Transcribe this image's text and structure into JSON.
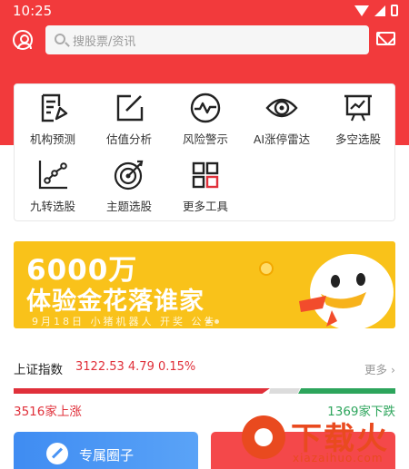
{
  "status_bar": {
    "time": "10:25"
  },
  "header": {
    "search_placeholder": "搜股票/资讯"
  },
  "tools": [
    {
      "label": "机构预测",
      "icon": "report-edit-icon"
    },
    {
      "label": "估值分析",
      "icon": "edit-square-icon"
    },
    {
      "label": "风险警示",
      "icon": "pulse-circle-icon"
    },
    {
      "label": "AI涨停雷达",
      "icon": "eye-icon"
    },
    {
      "label": "多空选股",
      "icon": "presentation-board-icon"
    },
    {
      "label": "九转选股",
      "icon": "trend-chart-icon"
    },
    {
      "label": "主题选股",
      "icon": "target-icon"
    },
    {
      "label": "更多工具",
      "icon": "grid-icon"
    }
  ],
  "banner": {
    "line1": "6000万",
    "line2": "体验金花落谁家",
    "line3": "9月18日 小猪机器人 开奖 公告"
  },
  "index": {
    "name": "上证指数",
    "value": "3122.53 4.79 0.15%",
    "more": "更多",
    "up_count": "3516家上涨",
    "down_count": "1369家下跌",
    "colors": {
      "up": "#e0303a",
      "down": "#2da55c",
      "flat": "#dcdcdc"
    }
  },
  "cards": [
    {
      "label": "专属圈子",
      "color": "#4a94f4"
    },
    {
      "label": "",
      "color": "#f4484a"
    }
  ],
  "watermark": {
    "title": "下载火",
    "url": "xiazaihuo.com"
  },
  "colors": {
    "brand_red": "#f23a3c",
    "banner_yellow": "#f9c21a"
  }
}
